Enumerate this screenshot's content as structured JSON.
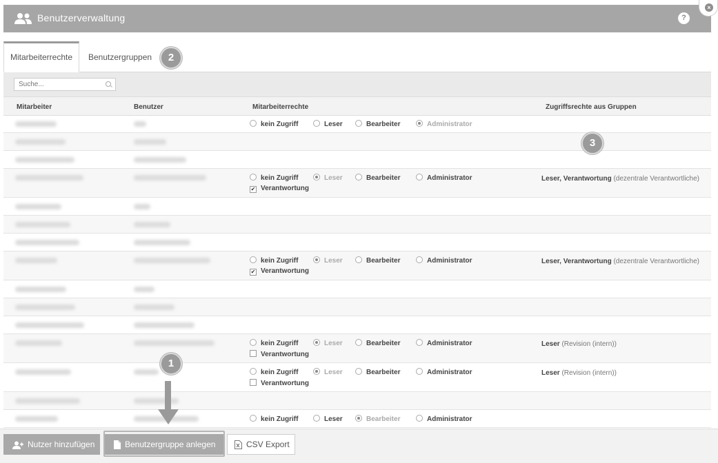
{
  "window": {
    "title": "Benutzerverwaltung",
    "help": "?",
    "close": "×"
  },
  "tabs": [
    {
      "label": "Mitarbeiterrechte"
    },
    {
      "label": "Benutzergruppen"
    }
  ],
  "markers": [
    "1",
    "2",
    "3"
  ],
  "search": {
    "placeholder": "Suche..."
  },
  "columns": {
    "employee": "Mitarbeiter",
    "user": "Benutzer",
    "rights": "Mitarbeiterrechte",
    "group_rights": "Zugriffsrechte aus Gruppen"
  },
  "options": {
    "none": "kein Zugriff",
    "reader": "Leser",
    "editor": "Bearbeiter",
    "admin": "Administrator",
    "responsibility": "Verantwortung"
  },
  "rows": [
    {
      "rights": {
        "selected": "admin"
      }
    },
    {},
    {},
    {
      "rights": {
        "selected": "reader",
        "responsibility": true
      },
      "groups": {
        "bold": "Leser, Verantwortung",
        "rest": " (dezentrale Verantwortliche)"
      }
    },
    {},
    {},
    {},
    {
      "rights": {
        "selected": "reader",
        "responsibility": true
      },
      "groups": {
        "bold": "Leser, Verantwortung",
        "rest": " (dezentrale Verantwortliche)"
      }
    },
    {},
    {},
    {},
    {
      "rights": {
        "selected": "reader",
        "responsibility": false
      },
      "groups": {
        "bold": "Leser",
        "rest": " (Revision (intern))"
      }
    },
    {
      "rights": {
        "selected": "reader",
        "responsibility": false
      },
      "groups": {
        "bold": "Leser",
        "rest": " (Revision (intern))"
      }
    },
    {},
    {
      "rights": {
        "selected": "editor"
      }
    }
  ],
  "footer": {
    "add_user": "Nutzer hinzufügen",
    "create_group": "Benutzergruppe anlegen",
    "csv_export": "CSV Export"
  }
}
